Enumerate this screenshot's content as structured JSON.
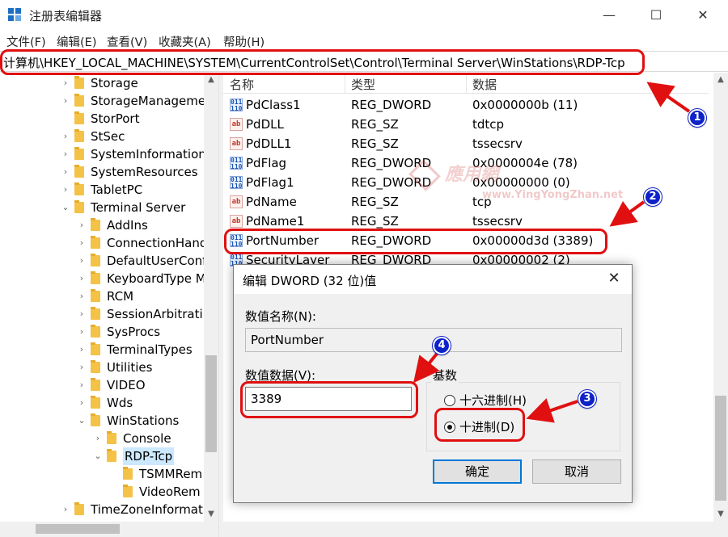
{
  "window": {
    "title": "注册表编辑器",
    "min": "—",
    "max": "☐",
    "close": "✕"
  },
  "menu": [
    "文件(F)",
    "编辑(E)",
    "查看(V)",
    "收藏夹(A)",
    "帮助(H)"
  ],
  "address": "计算机\\HKEY_LOCAL_MACHINE\\SYSTEM\\CurrentControlSet\\Control\\Terminal Server\\WinStations\\RDP-Tcp",
  "tree": [
    {
      "label": "Storage",
      "arrow": "›"
    },
    {
      "label": "StorageManageme",
      "arrow": "›"
    },
    {
      "label": "StorPort",
      "arrow": ""
    },
    {
      "label": "StSec",
      "arrow": "›"
    },
    {
      "label": "SystemInformation",
      "arrow": "›"
    },
    {
      "label": "SystemResources",
      "arrow": "›"
    },
    {
      "label": "TabletPC",
      "arrow": "›"
    },
    {
      "label": "Terminal Server",
      "arrow": "⌄"
    },
    {
      "label": "AddIns",
      "arrow": "›"
    },
    {
      "label": "ConnectionHand",
      "arrow": "›"
    },
    {
      "label": "DefaultUserConf",
      "arrow": "›"
    },
    {
      "label": "KeyboardType M",
      "arrow": "›"
    },
    {
      "label": "RCM",
      "arrow": "›"
    },
    {
      "label": "SessionArbitrati",
      "arrow": "›"
    },
    {
      "label": "SysProcs",
      "arrow": "›"
    },
    {
      "label": "TerminalTypes",
      "arrow": "›"
    },
    {
      "label": "Utilities",
      "arrow": "›"
    },
    {
      "label": "VIDEO",
      "arrow": "›"
    },
    {
      "label": "Wds",
      "arrow": "›"
    },
    {
      "label": "WinStations",
      "arrow": "⌄"
    },
    {
      "label": "Console",
      "arrow": "›"
    },
    {
      "label": "RDP-Tcp",
      "arrow": "⌄"
    },
    {
      "label": "TSMMRem",
      "arrow": ""
    },
    {
      "label": "VideoRem",
      "arrow": ""
    },
    {
      "label": "TimeZoneInformat",
      "arrow": "›"
    }
  ],
  "list": {
    "headers": [
      "名称",
      "类型",
      "数据"
    ],
    "rows": [
      {
        "icon": "dword-icon",
        "name": "PdClass1",
        "type": "REG_DWORD",
        "data": "0x0000000b (11)"
      },
      {
        "icon": "string-icon",
        "name": "PdDLL",
        "type": "REG_SZ",
        "data": "tdtcp"
      },
      {
        "icon": "string-icon",
        "name": "PdDLL1",
        "type": "REG_SZ",
        "data": "tssecsrv"
      },
      {
        "icon": "dword-icon",
        "name": "PdFlag",
        "type": "REG_DWORD",
        "data": "0x0000004e (78)"
      },
      {
        "icon": "dword-icon",
        "name": "PdFlag1",
        "type": "REG_DWORD",
        "data": "0x00000000 (0)"
      },
      {
        "icon": "string-icon",
        "name": "PdName",
        "type": "REG_SZ",
        "data": "tcp"
      },
      {
        "icon": "string-icon",
        "name": "PdName1",
        "type": "REG_SZ",
        "data": "tssecsrv"
      },
      {
        "icon": "dword-icon",
        "name": "PortNumber",
        "type": "REG_DWORD",
        "data": "0x00000d3d (3389)"
      },
      {
        "icon": "dword-icon",
        "name": "SecurityLayer",
        "type": "REG_DWORD",
        "data": "0x00000002 (2)"
      }
    ]
  },
  "dialog": {
    "title": "编辑 DWORD (32 位)值",
    "close": "✕",
    "name_label": "数值名称(N):",
    "name_value": "PortNumber",
    "data_label": "数值数据(V):",
    "data_value": "3389",
    "base_label": "基数",
    "hex_label": "十六进制(H)",
    "dec_label": "十进制(D)",
    "selected_base": "decimal",
    "ok": "确定",
    "cancel": "取消"
  },
  "annotations": [
    "1",
    "2",
    "3",
    "4"
  ],
  "watermark": {
    "line1": "應用網",
    "line2": "www.YingYongZhan.net"
  },
  "colors": {
    "highlight": "#e01010",
    "badge": "#0e22c8",
    "selection": "#cce8ff",
    "accent": "#0078d7"
  }
}
